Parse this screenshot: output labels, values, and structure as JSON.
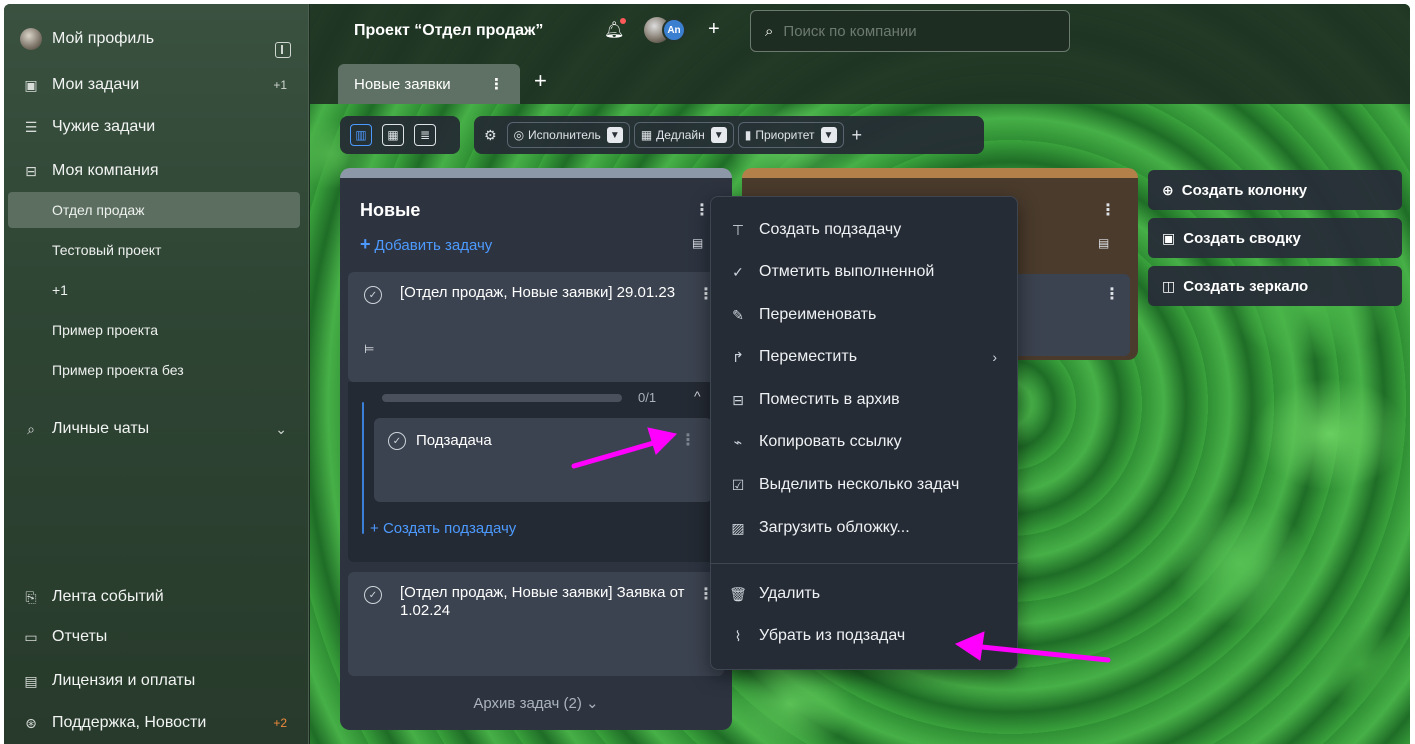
{
  "sidebar": {
    "profile": "Мой профиль",
    "my_tasks": "Мои задачи",
    "my_tasks_badge": "+1",
    "others_tasks": "Чужие задачи",
    "my_company": "Моя компания",
    "projects": [
      "Отдел продаж",
      "Тестовый проект",
      "+1",
      "Пример проекта",
      "Пример проекта без"
    ],
    "personal_chats": "Личные чаты",
    "events": "Лента событий",
    "reports": "Отчеты",
    "license": "Лицензия и оплаты",
    "support": "Поддержка, Новости",
    "support_badge": "+2"
  },
  "header": {
    "project_title": "Проект “Отдел продаж”",
    "avatar_initials": "An",
    "search_placeholder": "Поиск по компании"
  },
  "tabs": {
    "active": "Новые заявки"
  },
  "filters": {
    "assignee": "Исполнитель",
    "deadline": "Дедлайн",
    "priority": "Приоритет"
  },
  "board": {
    "column_title": "Новые",
    "add_task": "Добавить задачу",
    "cards": [
      {
        "title": "[Отдел продаж, Новые заявки] 29.01.23"
      },
      {
        "title": "[Отдел продаж, Новые заявки] Заявка от 1.02.24"
      }
    ],
    "progress_text": "0/1",
    "progress_fraction": 0,
    "subtask_title": "Подзадача",
    "create_subtask": "Создать подзадачу",
    "archive": "Архив задач (2)"
  },
  "right_buttons": [
    "Создать колонку",
    "Создать сводку",
    "Создать зеркало"
  ],
  "menu": {
    "items": [
      "Создать подзадачу",
      "Отметить выполненной",
      "Переименовать",
      "Переместить",
      "Поместить в архив",
      "Копировать ссылку",
      "Выделить несколько задач",
      "Загрузить обложку...",
      "Удалить",
      "Убрать из подзадач"
    ]
  },
  "colors": {
    "accent": "#4d9aff",
    "annotation_arrow": "#ff00ff",
    "badge_orange": "#f08a3c"
  }
}
